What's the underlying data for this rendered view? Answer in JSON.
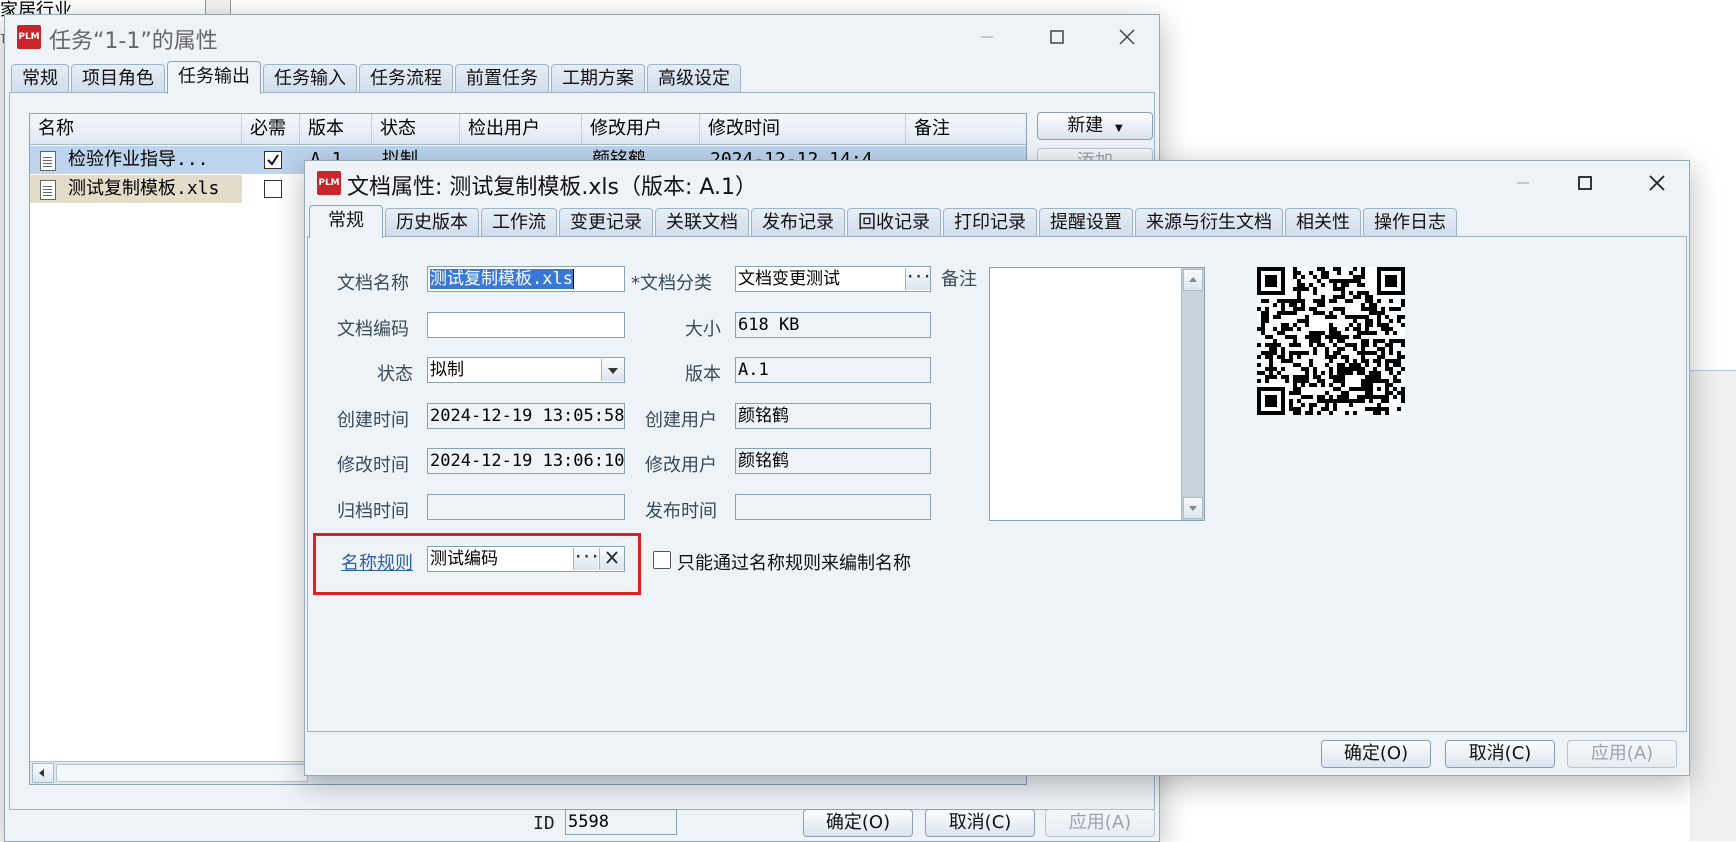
{
  "background": {
    "left_text_1": "家居行业",
    "left_text_2": "亡"
  },
  "back_window": {
    "title": "任务“1-1”的属性",
    "tabs": [
      "常规",
      "项目角色",
      "任务输出",
      "任务输入",
      "任务流程",
      "前置任务",
      "工期方案",
      "高级设定"
    ],
    "active_tab": "任务输出",
    "columns": [
      "名称",
      "必需",
      "版本",
      "状态",
      "检出用户",
      "修改用户",
      "修改时间",
      "备注"
    ],
    "rows": [
      {
        "name": "检验作业指导...",
        "required": true,
        "version": "A.1",
        "status": "拟制",
        "checkout_user": "",
        "modify_user": "颜铭鹤",
        "modify_time": "2024-12-12 14:4",
        "note": ""
      },
      {
        "name": "测试复制模板.xls",
        "required": false,
        "version": "",
        "status": "",
        "checkout_user": "",
        "modify_user": "",
        "modify_time": "",
        "note": ""
      }
    ],
    "new_button": "新建",
    "add_button": "添加",
    "id_label": "ID",
    "id_value": "5598",
    "ok_button": "确定(O)",
    "cancel_button": "取消(C)",
    "apply_button": "应用(A)"
  },
  "front_window": {
    "title": "文档属性: 测试复制模板.xls（版本: A.1）",
    "tabs": [
      "常规",
      "历史版本",
      "工作流",
      "变更记录",
      "关联文档",
      "发布记录",
      "回收记录",
      "打印记录",
      "提醒设置",
      "来源与衍生文档",
      "相关性",
      "操作日志"
    ],
    "active_tab": "常规",
    "labels": {
      "doc_name": "文档名称",
      "doc_code": "文档编码",
      "status": "状态",
      "created_time": "创建时间",
      "modified_time": "修改时间",
      "archived_time": "归档时间",
      "naming_rule": "名称规则",
      "doc_category": "*文档分类",
      "size": "大小",
      "version": "版本",
      "creator": "创建用户",
      "modifier": "修改用户",
      "publish_time": "发布时间",
      "remarks": "备注",
      "only_by_rule": "只能通过名称规则来编制名称"
    },
    "values": {
      "doc_name": "测试复制模板.xls",
      "doc_code": "",
      "status": "拟制",
      "created_time": "2024-12-19 13:05:58",
      "modified_time": "2024-12-19 13:06:10",
      "archived_time": "",
      "naming_rule": "测试编码",
      "doc_category": "文档变更测试",
      "size": "618 KB",
      "version": "A.1",
      "creator": "颜铭鹤",
      "modifier": "颜铭鹤",
      "publish_time": "",
      "remarks": ""
    },
    "only_by_rule_checked": false,
    "ok_button": "确定(O)",
    "cancel_button": "取消(C)",
    "apply_button": "应用(A)"
  },
  "colors": {
    "window_bg": "#eef3f8",
    "tab_border": "#9fb3c8",
    "selection_blue": "#bcd4ee",
    "selection_beige": "#e2dcc8",
    "highlight_red": "#e02020",
    "link": "#2e62a8",
    "plm_red": "#c8262a"
  },
  "icons": [
    "plm-app-icon",
    "minimize-icon",
    "maximize-icon",
    "close-icon",
    "document-icon",
    "dropdown-arrow-icon",
    "ellipsis-icon",
    "clear-x-icon",
    "scroll-up-icon",
    "scroll-down-icon",
    "scroll-left-icon",
    "qr-code-icon"
  ]
}
